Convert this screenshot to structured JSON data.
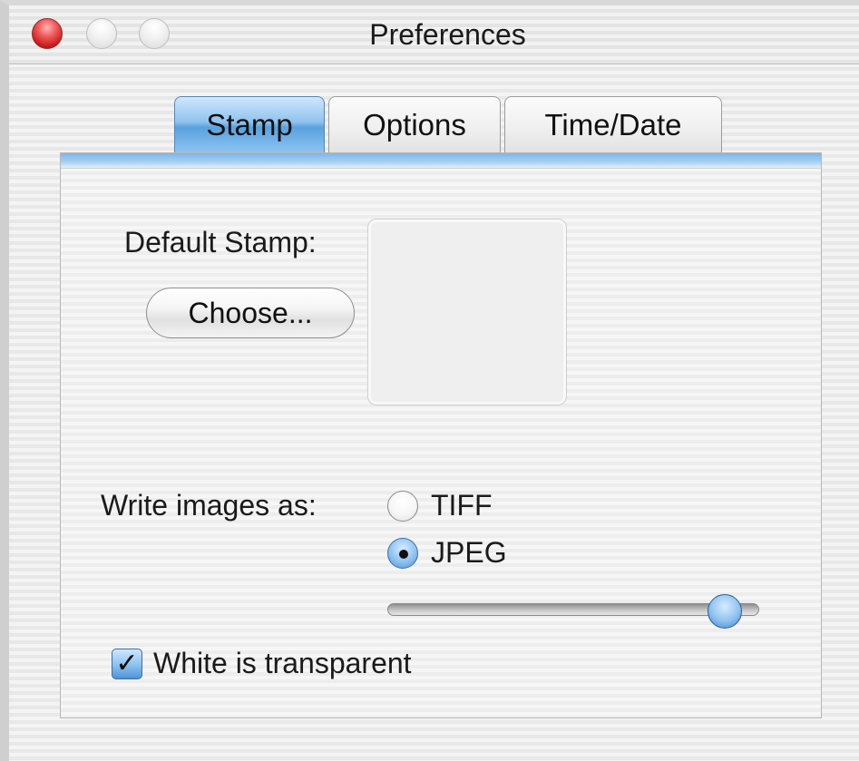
{
  "window": {
    "title": "Preferences",
    "controls": {
      "close_icon": "close-icon",
      "minimize_icon": "minimize-icon",
      "zoom_icon": "zoom-icon"
    }
  },
  "tabs": [
    {
      "label": "Stamp",
      "selected": true
    },
    {
      "label": "Options",
      "selected": false
    },
    {
      "label": "Time/Date",
      "selected": false
    }
  ],
  "stamp": {
    "default_stamp_label": "Default Stamp:",
    "choose_button": "Choose...",
    "stamp_preview_icon": "image-well-icon",
    "write_images_label": "Write images as:",
    "formats": [
      {
        "label": "TIFF",
        "checked": false
      },
      {
        "label": "JPEG",
        "checked": true
      }
    ],
    "jpeg_quality_percent": 95,
    "white_transparent_label": "White is transparent",
    "white_transparent_checked": true
  },
  "colors": {
    "accent": "#5aa1de",
    "close_red": "#c81818"
  }
}
